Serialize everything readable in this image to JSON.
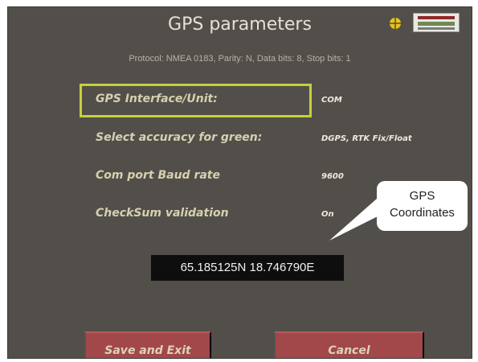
{
  "header": {
    "title": "GPS parameters",
    "protocol_line": "Protocol: NMEA 0183, Parity: N, Data bits: 8, Stop bits: 1"
  },
  "icons": {
    "gps": "gps-crosshair-icon",
    "status": "signal-status-icon"
  },
  "params": [
    {
      "label": "GPS Interface/Unit:",
      "value": "COM",
      "selected": true
    },
    {
      "label": "Select accuracy for green:",
      "value": "DGPS, RTK Fix/Float"
    },
    {
      "label": "Com port Baud rate",
      "value": "9600"
    },
    {
      "label": "CheckSum validation",
      "value": "On"
    }
  ],
  "coordinates": "65.185125N  18.746790E",
  "callout": {
    "line1": "GPS",
    "line2": "Coordinates"
  },
  "buttons": {
    "save": "Save and Exit",
    "cancel": "Cancel"
  },
  "colors": {
    "background": "#524f4a",
    "highlight": "#c8cf3c",
    "button": "#a3484a",
    "label": "#d7d0b0"
  }
}
